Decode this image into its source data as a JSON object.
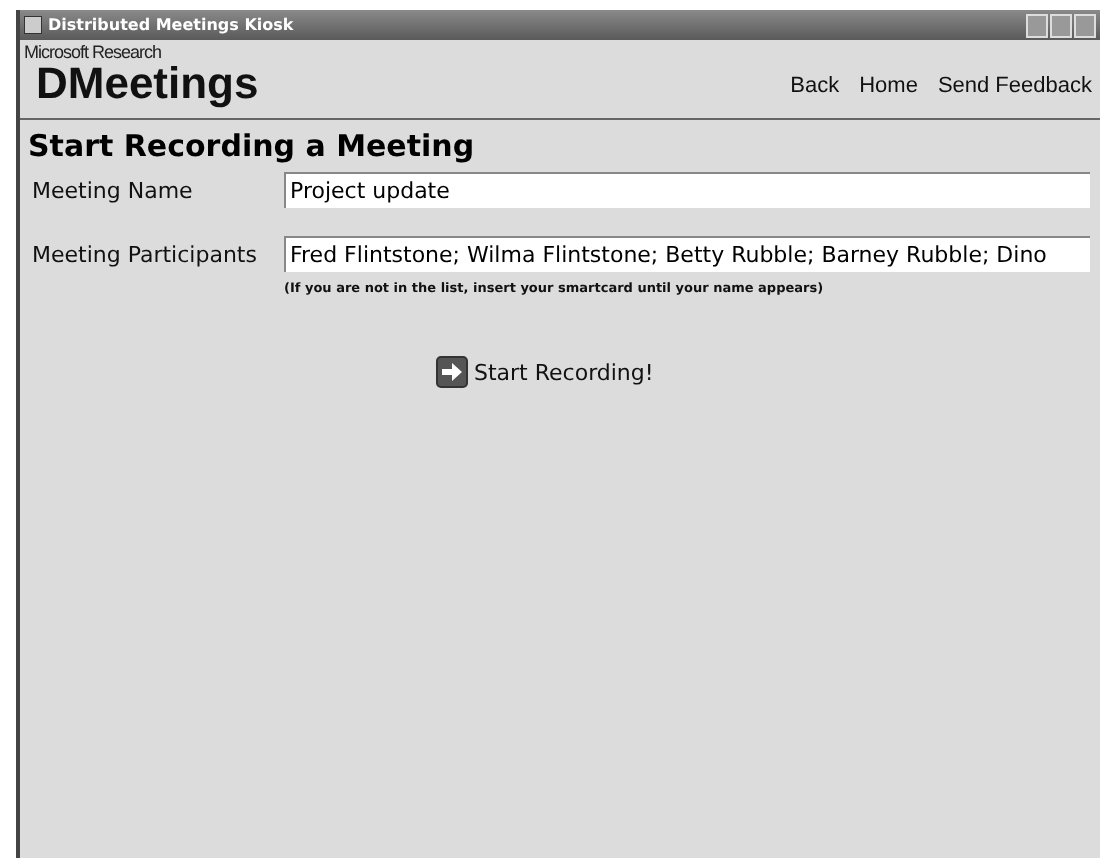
{
  "window": {
    "title": "Distributed Meetings Kiosk"
  },
  "header": {
    "brand_small": "Microsoft Research",
    "brand": "DMeetings",
    "nav": [
      "Back",
      "Home",
      "Send Feedback"
    ]
  },
  "heading": "Start Recording a Meeting",
  "fields": [
    {
      "label": "Meeting Name",
      "value": "Project update"
    },
    {
      "label": "Meeting Participants",
      "value": "Fred Flintstone; Wilma Flintstone; Betty Rubble; Barney Rubble; Dino",
      "hint": "(If you are not in the list, insert your smartcard until your name appears)"
    }
  ],
  "action": {
    "label": "Start Recording!"
  }
}
